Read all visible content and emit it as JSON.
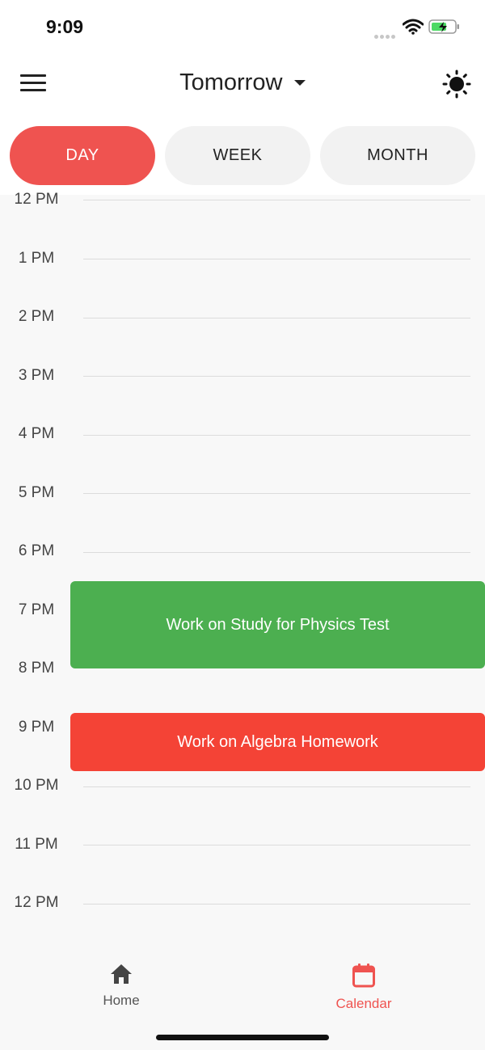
{
  "status_bar": {
    "time": "9:09",
    "icons": [
      "signal-dots-icon",
      "wifi-icon",
      "battery-charging-icon"
    ]
  },
  "header": {
    "title": "Tomorrow",
    "menu_icon": "hamburger-menu-icon",
    "dropdown_icon": "caret-down-icon",
    "theme_icon": "sun-icon"
  },
  "tabs": [
    {
      "label": "DAY",
      "active": true
    },
    {
      "label": "WEEK",
      "active": false
    },
    {
      "label": "MONTH",
      "active": false
    }
  ],
  "hours": [
    "12 PM",
    "1 PM",
    "2 PM",
    "3 PM",
    "4 PM",
    "5 PM",
    "6 PM",
    "7 PM",
    "8 PM",
    "9 PM",
    "10 PM",
    "11 PM",
    "12 PM"
  ],
  "events": [
    {
      "title": "Work on Study for Physics Test",
      "color": "#4caf50"
    },
    {
      "title": "Work on Algebra Homework",
      "color": "#f44336"
    }
  ],
  "bottom_nav": [
    {
      "label": "Home",
      "icon": "home-icon",
      "active": false
    },
    {
      "label": "Calendar",
      "icon": "calendar-icon",
      "active": true
    }
  ],
  "colors": {
    "accent": "#ef5350",
    "nav_inactive": "#555555"
  }
}
